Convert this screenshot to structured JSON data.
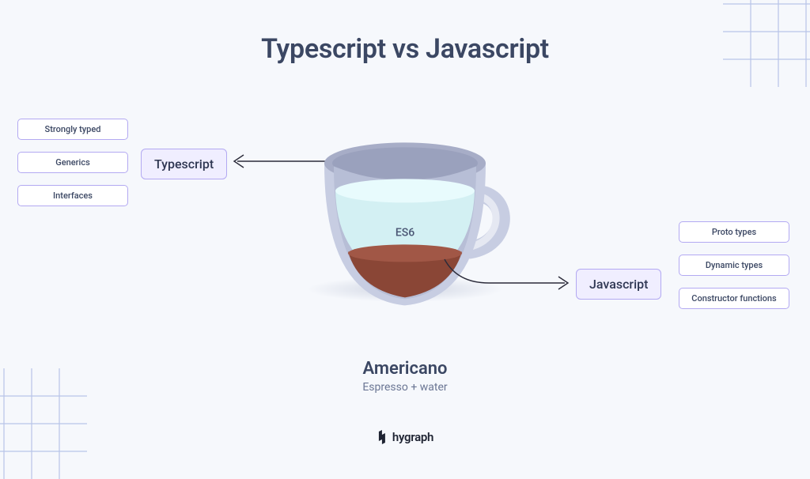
{
  "title": "Typescript vs Javascript",
  "cup": {
    "upper_label": "ES6",
    "caption_title": "Americano",
    "caption_sub": "Espresso + water"
  },
  "left": {
    "pill": "Typescript",
    "features": [
      "Strongly typed",
      "Generics",
      "Interfaces"
    ]
  },
  "right": {
    "pill": "Javascript",
    "features": [
      "Proto types",
      "Dynamic types",
      "Constructor functions"
    ]
  },
  "brand": "hygraph",
  "colors": {
    "cup_rim": "#a7adc7",
    "cup_body": "#c7cde2",
    "water": "#d3f0f3",
    "water_top": "#e8fbfd",
    "espresso": "#8a4636",
    "espresso_top": "#a15746"
  }
}
